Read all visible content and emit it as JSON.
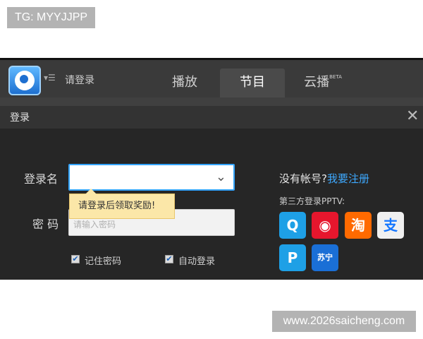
{
  "watermark_top": "TG: MYYJJPP",
  "watermark_bottom": "www.2026saicheng.com",
  "topbar": {
    "login_link": "请登录",
    "menu_glyph": "▾☰",
    "tabs": [
      {
        "label": "播放"
      },
      {
        "label": "节目"
      },
      {
        "label": "云播",
        "badge": "BETA"
      }
    ]
  },
  "dialog": {
    "title": "登录",
    "close": "✕",
    "username_label": "登录名",
    "username_value": "",
    "dropdown_glyph": "⌄",
    "tooltip": "请登录后领取奖励!",
    "password_label": "密 码",
    "password_placeholder": "请输入密码",
    "remember_label": "记住密码",
    "remember_checked": true,
    "autologin_label": "自动登录",
    "autologin_checked": true,
    "no_account": "没有帐号?",
    "register": "我要注册",
    "third_party": "第三方登录PPTV:",
    "social": [
      {
        "name": "qq-icon",
        "glyph": "Q",
        "color": "#1ea0e6"
      },
      {
        "name": "weibo-icon",
        "glyph": "◉",
        "color": "#e6162d"
      },
      {
        "name": "taobao-icon",
        "glyph": "淘",
        "color": "#ff6a00"
      },
      {
        "name": "alipay-icon",
        "glyph": "支",
        "color": "#f0f0f0"
      },
      {
        "name": "pptv-icon",
        "glyph": "P",
        "color": "#1ea0e6"
      },
      {
        "name": "suning-icon",
        "glyph": "苏宁",
        "color": "#1a6fd6"
      }
    ]
  },
  "colors": {
    "accent": "#3ea9ff",
    "tooltip_bg": "#fbe7a8"
  }
}
